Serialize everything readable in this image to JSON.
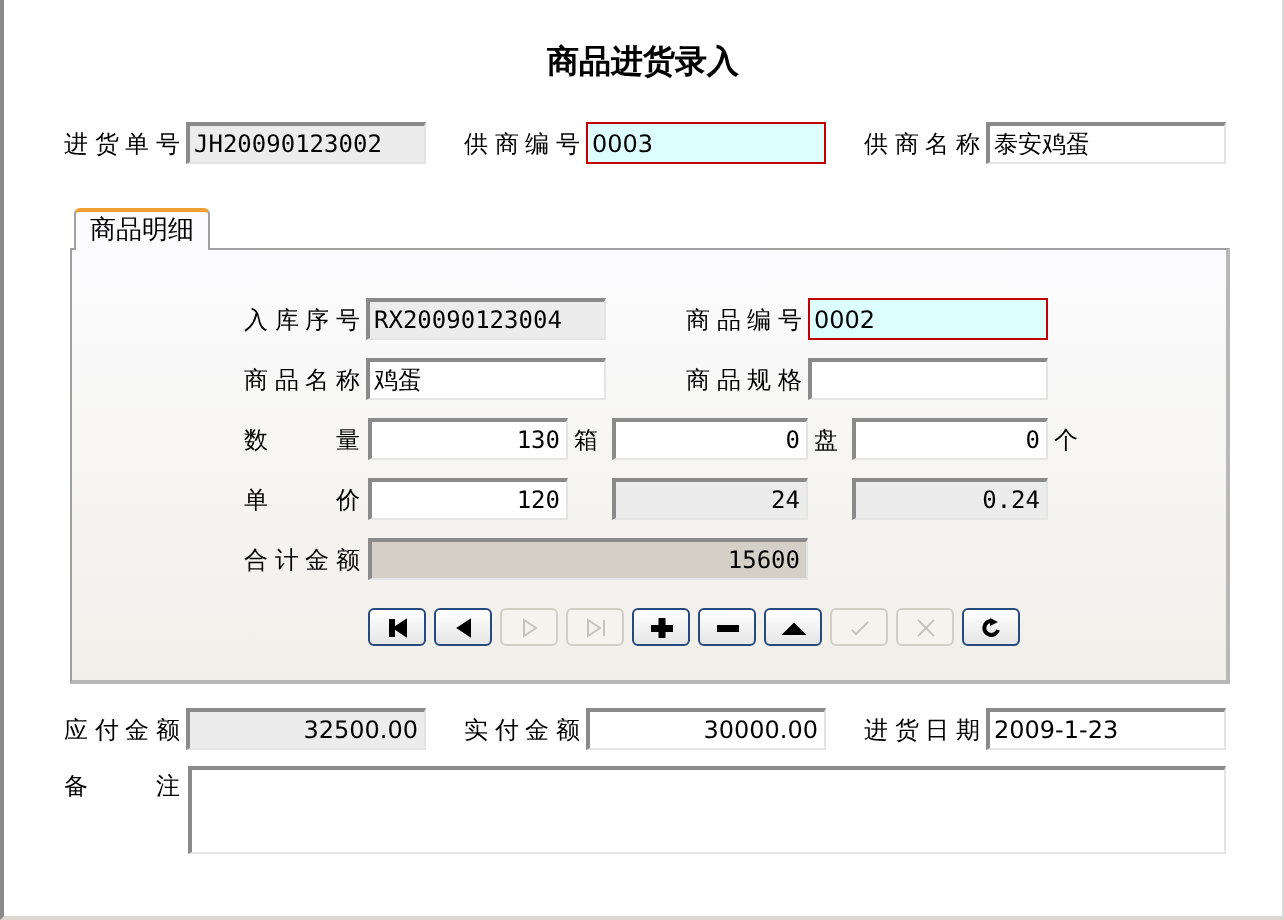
{
  "title": "商品进货录入",
  "header_fields": [
    {
      "label": "进货单号",
      "value": "JH20090123002",
      "kind": "readonly"
    },
    {
      "label": "供商编号",
      "value": "0003",
      "kind": "focused"
    },
    {
      "label": "供商名称",
      "value": "泰安鸡蛋",
      "kind": "normal"
    }
  ],
  "tab": {
    "label": "商品明细",
    "selected": true
  },
  "detail": {
    "id_fields": [
      {
        "label": "入库序号",
        "value": "RX20090123004",
        "kind": "readonly"
      },
      {
        "label": "商品编号",
        "value": "0002",
        "kind": "focused"
      },
      {
        "label": "商品名称",
        "value": "鸡蛋",
        "kind": "normal"
      },
      {
        "label": "商品规格",
        "kind": "normal"
      }
    ],
    "quantity": {
      "label": "数量",
      "entries": [
        {
          "value": "130",
          "unit": "箱"
        },
        {
          "value": "0",
          "unit": "盘"
        },
        {
          "value": "0",
          "unit": "个"
        }
      ]
    },
    "price": {
      "label": "单价",
      "entries": [
        {
          "value": "120",
          "kind": "normal"
        },
        {
          "value": "24",
          "kind": "readonly"
        },
        {
          "value": "0.24",
          "kind": "readonly"
        }
      ]
    },
    "total": {
      "label": "合计金额",
      "value": "15600",
      "kind": "total"
    },
    "nav_buttons": [
      {
        "kind": "first",
        "disabled": false
      },
      {
        "kind": "prev",
        "disabled": false
      },
      {
        "kind": "next",
        "disabled": true
      },
      {
        "kind": "last",
        "disabled": true
      },
      {
        "kind": "add",
        "disabled": false
      },
      {
        "kind": "remove",
        "disabled": false
      },
      {
        "kind": "edit",
        "disabled": false
      },
      {
        "kind": "save",
        "disabled": true
      },
      {
        "kind": "cancel",
        "disabled": true
      },
      {
        "kind": "refresh",
        "disabled": false
      }
    ]
  },
  "footer_fields": [
    {
      "label": "应付金额",
      "value": "32500.00",
      "kind": "readonly"
    },
    {
      "label": "实付金额",
      "value": "30000.00",
      "kind": "normal"
    },
    {
      "label": "进货日期",
      "value": "2009-1-23",
      "kind": "normal"
    }
  ],
  "remarks": {
    "label": "备注"
  }
}
